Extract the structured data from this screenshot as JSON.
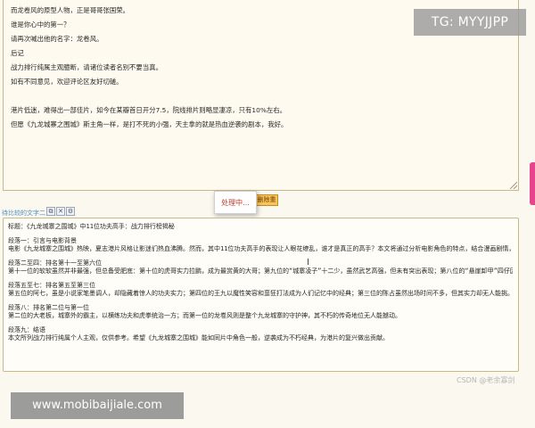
{
  "source_lines": [
    "而龙卷风的原型人物，正是哥哥张国荣。",
    "谁是你心中的第一？",
    "请再次喊出他的名字：龙卷风。",
    "后记",
    "战力排行纯属主观臆断，请诸位读者名别不要当真。",
    "如有不同意见，欢迎评论区友好切磋。",
    "",
    "港片低迷，难得出一部佳片，如今在某瓣首日开分7.5，院线排片则略显凄凉，只有10%左右。",
    "但愿《九龙城寨之围城》斯主角一样，是打不死的小强，天主拿的就是热血逆袭的剧本，我好。"
  ],
  "toolbar": {
    "label": "待比较的文字二",
    "copy_icon": "⧉",
    "clear_icon": "✕",
    "settings_icon": "⚙",
    "action_label": "删除重"
  },
  "popup": {
    "text": "处理中..."
  },
  "result_lines": [
    "标题：《九龙城寨之围城》中11位功夫高手：战力排行榜揭秘",
    "段落一：引言与电影背景",
    "电影《九龙城寨之围城》热映，夏志港片风格让影迷们热血沸腾。然而，其中11位功夫高手的表现让人眼花缭乱，谁才是真正的高手？本文将通过分析电影角色的特点，结合漫画剧情，揭晓他们的战力排行。",
    "",
    "段落二至四：排名第十一至第六位",
    "第十一位的软软虽然并非最强，但总备受肥底：第十位的虎哥实力拉鹏，成为最赏黄的大哥；第九位的“城寨凌子”十二少，虽然武艺高强，但未有突出表现；第八位的“悬崖卸甲”四仔因犍草社会知道而神秘翼丽；第七位的“龙城一刀”信一以狠刺闻颖悲息险横风勇，诸称抬身故击专家；第六位的欧爱“拳堂”陈洛军则以韧强的生命力和血性的特点成为不朽经典。",
    "",
    "段落五至七：排名第五至第三位",
    "第五位的阿七，虽是小说家笔墨调人，却隐藏着惊人的功夫实力；第四位的王九以魔性笑容和蛮狂打法成为人们记忆中的经典；第三位的陈占虽然出场时间不多，但其实力却无人能挑。",
    "",
    "段落八：排名第二位与第一位",
    "第二位的大老板，城寨外的霸主，以横练功夫和虎拳统治一方；而第一位的龙卷风则是整个九龙城寨的守护神，其不朽的传奇地位无人能撼动。",
    "",
    "段落九：结语",
    "本文所列战力排行纯属个人主观，仅供参考。希望《九龙城寨之围城》能如同片中角色一般，逆袭成为不朽经典，为港片的复兴做出贡献。"
  ],
  "watermarks": {
    "top": "TG: MYYJJPP",
    "bottom": "www.mobibaijiale.com",
    "csdn": "CSDN @老余寡剑"
  }
}
